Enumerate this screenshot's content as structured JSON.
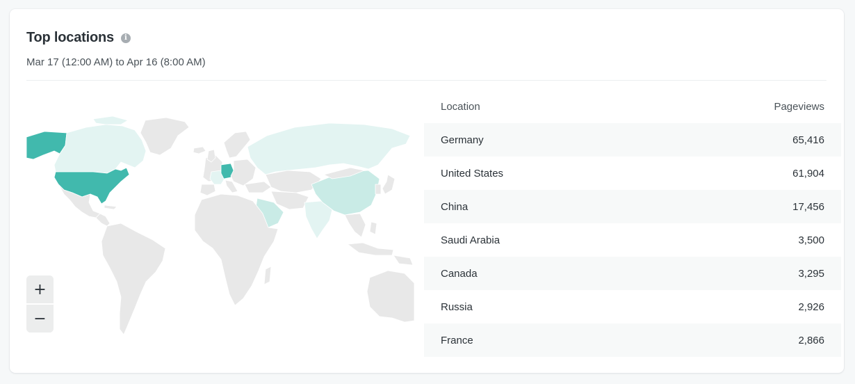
{
  "widget": {
    "title": "Top locations",
    "info_icon": "info-icon",
    "date_range": "Mar 17 (12:00 AM) to Apr 16 (8:00 AM)"
  },
  "map": {
    "zoom_in_label": "+",
    "zoom_out_label": "−",
    "colors": {
      "land": "#e8e8e8",
      "high": "#41b9ad",
      "medium": "#c9ebe6",
      "low": "#e3f4f2",
      "border": "#ffffff"
    }
  },
  "table": {
    "columns": [
      "Location",
      "Pageviews"
    ],
    "rows": [
      {
        "location": "Germany",
        "pageviews": "65,416"
      },
      {
        "location": "United States",
        "pageviews": "61,904"
      },
      {
        "location": "China",
        "pageviews": "17,456"
      },
      {
        "location": "Saudi Arabia",
        "pageviews": "3,500"
      },
      {
        "location": "Canada",
        "pageviews": "3,295"
      },
      {
        "location": "Russia",
        "pageviews": "2,926"
      },
      {
        "location": "France",
        "pageviews": "2,866"
      }
    ]
  }
}
